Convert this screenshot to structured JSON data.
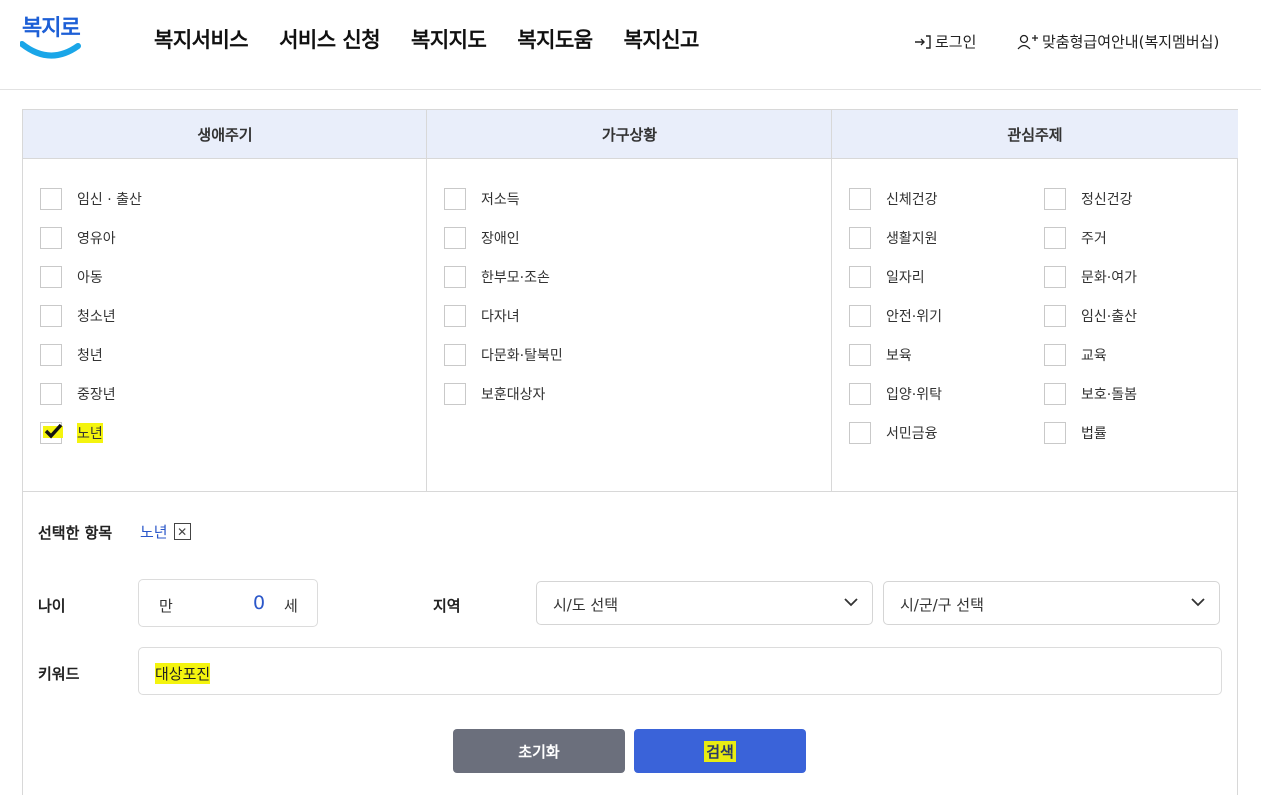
{
  "header": {
    "logo_text": "복지로",
    "nav": [
      "복지서비스",
      "서비스 신청",
      "복지지도",
      "복지도움",
      "복지신고"
    ],
    "login_label": "로그인",
    "member_label": "맞춤형급여안내(복지멤버십)"
  },
  "filters": {
    "columns": [
      {
        "title": "생애주기",
        "items": [
          {
            "label": "임신 · 출산",
            "checked": false
          },
          {
            "label": "영유아",
            "checked": false
          },
          {
            "label": "아동",
            "checked": false
          },
          {
            "label": "청소년",
            "checked": false
          },
          {
            "label": "청년",
            "checked": false
          },
          {
            "label": "중장년",
            "checked": false
          },
          {
            "label": "노년",
            "checked": true
          }
        ]
      },
      {
        "title": "가구상황",
        "items": [
          {
            "label": "저소득",
            "checked": false
          },
          {
            "label": "장애인",
            "checked": false
          },
          {
            "label": "한부모·조손",
            "checked": false
          },
          {
            "label": "다자녀",
            "checked": false
          },
          {
            "label": "다문화·탈북민",
            "checked": false
          },
          {
            "label": "보훈대상자",
            "checked": false
          }
        ]
      },
      {
        "title": "관심주제",
        "items": [
          {
            "label": "신체건강",
            "checked": false
          },
          {
            "label": "정신건강",
            "checked": false
          },
          {
            "label": "생활지원",
            "checked": false
          },
          {
            "label": "주거",
            "checked": false
          },
          {
            "label": "일자리",
            "checked": false
          },
          {
            "label": "문화·여가",
            "checked": false
          },
          {
            "label": "안전·위기",
            "checked": false
          },
          {
            "label": "임신·출산",
            "checked": false
          },
          {
            "label": "보육",
            "checked": false
          },
          {
            "label": "교육",
            "checked": false
          },
          {
            "label": "입양·위탁",
            "checked": false
          },
          {
            "label": "보호·돌봄",
            "checked": false
          },
          {
            "label": "서민금융",
            "checked": false
          },
          {
            "label": "법률",
            "checked": false
          }
        ]
      }
    ]
  },
  "selected": {
    "label": "선택한 항목",
    "tags": [
      "노년"
    ],
    "remove_icon": "close-icon"
  },
  "age": {
    "label": "나이",
    "prefix": "만",
    "value": "0",
    "suffix": "세"
  },
  "region": {
    "label": "지역",
    "sido": "시/도 선택",
    "sigungu": "시/군/구 선택"
  },
  "keyword": {
    "label": "키워드",
    "value": "대상포진"
  },
  "buttons": {
    "reset": "초기화",
    "search": "검색"
  },
  "colors": {
    "accent": "#3a63d9",
    "header_bg": "#e9eefa",
    "highlight": "#f4f40e",
    "reset_btn": "#6b6f7c"
  }
}
